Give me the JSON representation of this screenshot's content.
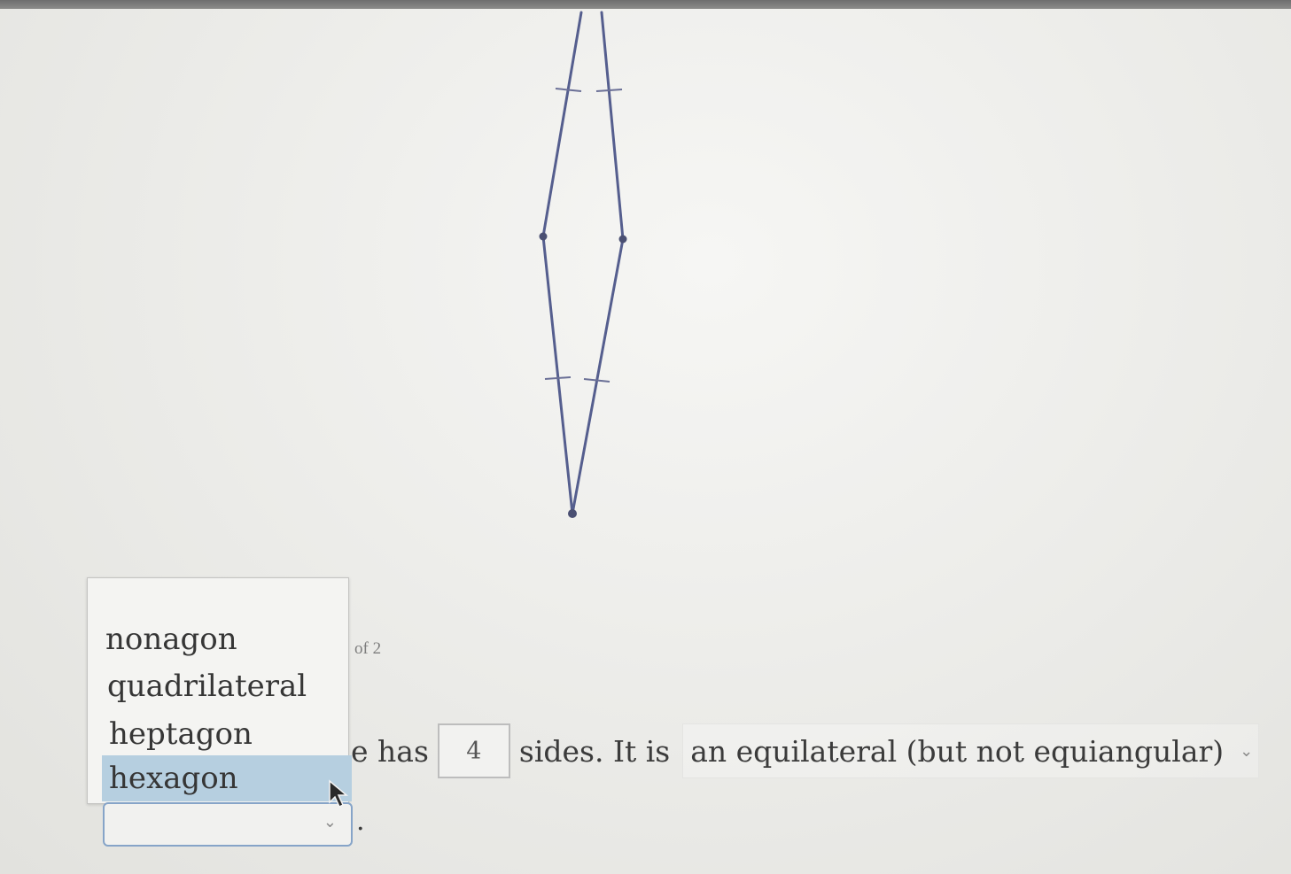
{
  "header": {
    "page_indicator": "of 2"
  },
  "question": {
    "text_before": "e has",
    "sides_value": "4",
    "text_middle": "sides. It is",
    "type_selected": "an equilateral (but not equiangular)",
    "text_end": "."
  },
  "dropdown": {
    "options": [
      "nonagon",
      "quadrilateral",
      "heptagon",
      "hexagon"
    ],
    "highlighted": "hexagon"
  },
  "icons": {
    "chevron": "⌄",
    "select_chevron_icon": "chevron-down-icon",
    "cursor_icon": "mouse-pointer-icon"
  },
  "colors": {
    "figure_stroke": "#555e8e",
    "figure_vertex": "#4a4f72",
    "highlight": "#b6cfe0",
    "select_border": "#86a4c8"
  }
}
